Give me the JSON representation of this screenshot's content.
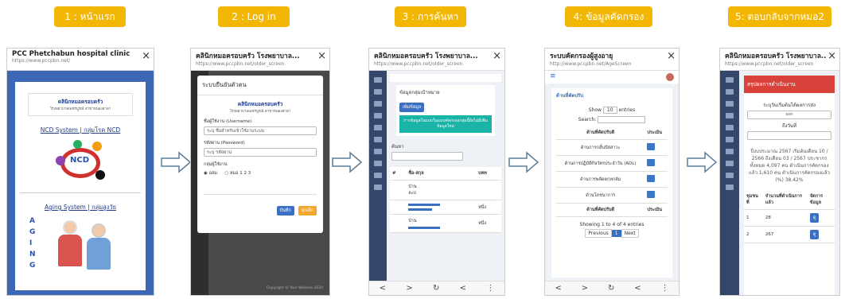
{
  "steps": [
    {
      "label": "1 : หน้าแรก"
    },
    {
      "label": "2 : Log in"
    },
    {
      "label": "3 : การค้นหา"
    },
    {
      "label": "4: ข้อมูลคัดกรอง"
    },
    {
      "label": "5: ตอบกลับจากหมอ2"
    }
  ],
  "s1": {
    "title": "PCC Phetchabun hospital clinic",
    "url": "https://www.pccpbn.net/",
    "close": "×",
    "clinic_title": "คลินิกหมอครอบครัว",
    "clinic_sub": "โรงพยาบาลเพชรบูรณ์ สาขาหนองสาลา",
    "ncd_link": "NCD System | กลุ่มโรค NCD",
    "ncd_logo": "NCD",
    "aging_link": "Aging System | กลุ่มสูงวัย",
    "aging_letters": [
      "A",
      "G",
      "I",
      "N",
      "G"
    ]
  },
  "s2": {
    "title": "คลินิกหมอครอบครัว โรงพยาบาล...",
    "url": "https://www.pccpbn.net/older_screen",
    "close": "×",
    "modal_title": "ระบบยืนยันตัวตน",
    "clinic_title": "คลินิกหมอครอบครัว",
    "clinic_sub": "โรงพยาบาลเพชรบูรณ์ สาขาหนองสาลา",
    "user_label": "ชื่อผู้ใช้งาน (Username)",
    "user_placeholder": "ระบุ ชื่อสำหรับเข้าใช้งานระบบ",
    "pass_label": "รหัสผ่าน (Password)",
    "pass_placeholder": "ระบุ รหัสผ่าน",
    "group_label": "กลุ่มผู้ใช้งาน",
    "radio1": "อสม.",
    "radio2": "หมอ 1 2 3",
    "btn_submit": "บันทึก",
    "btn_cancel": "ยกเลิก",
    "footer": "Copyright © Your Website 2020"
  },
  "s3": {
    "title": "คลินิกหมอครอบครัว โรงพยาบาล...",
    "url": "https://www.pccpbn.net/older_screen",
    "close": "×",
    "card_title": "ข้อมูลกลุ่มเป้าหมาย",
    "btn_search": "เพิ่มข้อมูล",
    "teal_text": "การข้อมูลในแบบในแบบคัดกรองกลุ่มนี้ยังไม่มีเพิ่มข้อมูลใหม่",
    "search_label": "ค้นหา",
    "col1": "#",
    "col2": "ชื่อ-สกุล",
    "col3": "บทท",
    "row_tag": "บ้าน",
    "row_tag2": "ละบ",
    "nav": [
      "<",
      ">",
      "↻",
      "<",
      "⋮"
    ]
  },
  "s4": {
    "title": "ระบบคัดกรองผู้สูงอายุ",
    "url": "http://www.pccpbn.net/AgeScreen",
    "close": "×",
    "menu": "≡",
    "card_title": "ด้านที่คัดปรับ",
    "show_label": "Show",
    "show_value": "10",
    "show_suffix": "entries",
    "search_label": "Search:",
    "th1": "ด้านที่คัดปรับดี",
    "th2": "ประเมิน",
    "rows": [
      "ด้านการกลั้นปัสสาวะ",
      "ด้านการปฏิบัติกิจวัตรประจำวัน (ADL)",
      "ด้านการพลัดตกหกล้ม",
      "ด้านโภชนาการ"
    ],
    "footer_th1": "ด้านที่คัดปรับดี",
    "footer_th2": "ประเมิน",
    "showing": "Showing 1 to 4 of 4 entries",
    "prev": "Previous",
    "page": "1",
    "next": "Next",
    "nav": [
      "<",
      ">",
      "↻",
      "<",
      "⋮"
    ]
  },
  "s5": {
    "title": "คลินิกหมอครอบครัว โรงพยาบาล...",
    "url": "https://www.pccpbn.net/older_screen",
    "close": "×",
    "header": "สรุปผลการดำเนินงาน",
    "select1_label": "ระบุวันเริ่มต้นได้ผลการส่ง",
    "select1_val": "ssn",
    "select2_label": "ถึงวันที่",
    "summary": "ปีงบประมาณ 2567 เริ่มต้นเดือน 10 / 2566 ถึงเดือน 03 / 2567 ประชากรทั้งหมด 4,097 คน ดำเนินการคัดกรองแล้ว 1,610 คน ดำเนินการคัดกรองแล้ว (%) 38.42%",
    "th1": "ชุมชนที่",
    "th2": "จำนวนที่ดำเนินการแล้ว",
    "th3": "จัดการข้อมูล",
    "row1_a": "1",
    "row1_b": "28",
    "row_btn": "ดู",
    "row2_a": "2",
    "row2_b": "267"
  },
  "colors": {
    "step": "#f2b705",
    "phone_blue": "#3b67b5",
    "sidebar": "#34476a",
    "teal": "#19b3a8",
    "red": "#d9413b",
    "btn_blue": "#3a6fc3",
    "btn_orange": "#f0a830"
  }
}
